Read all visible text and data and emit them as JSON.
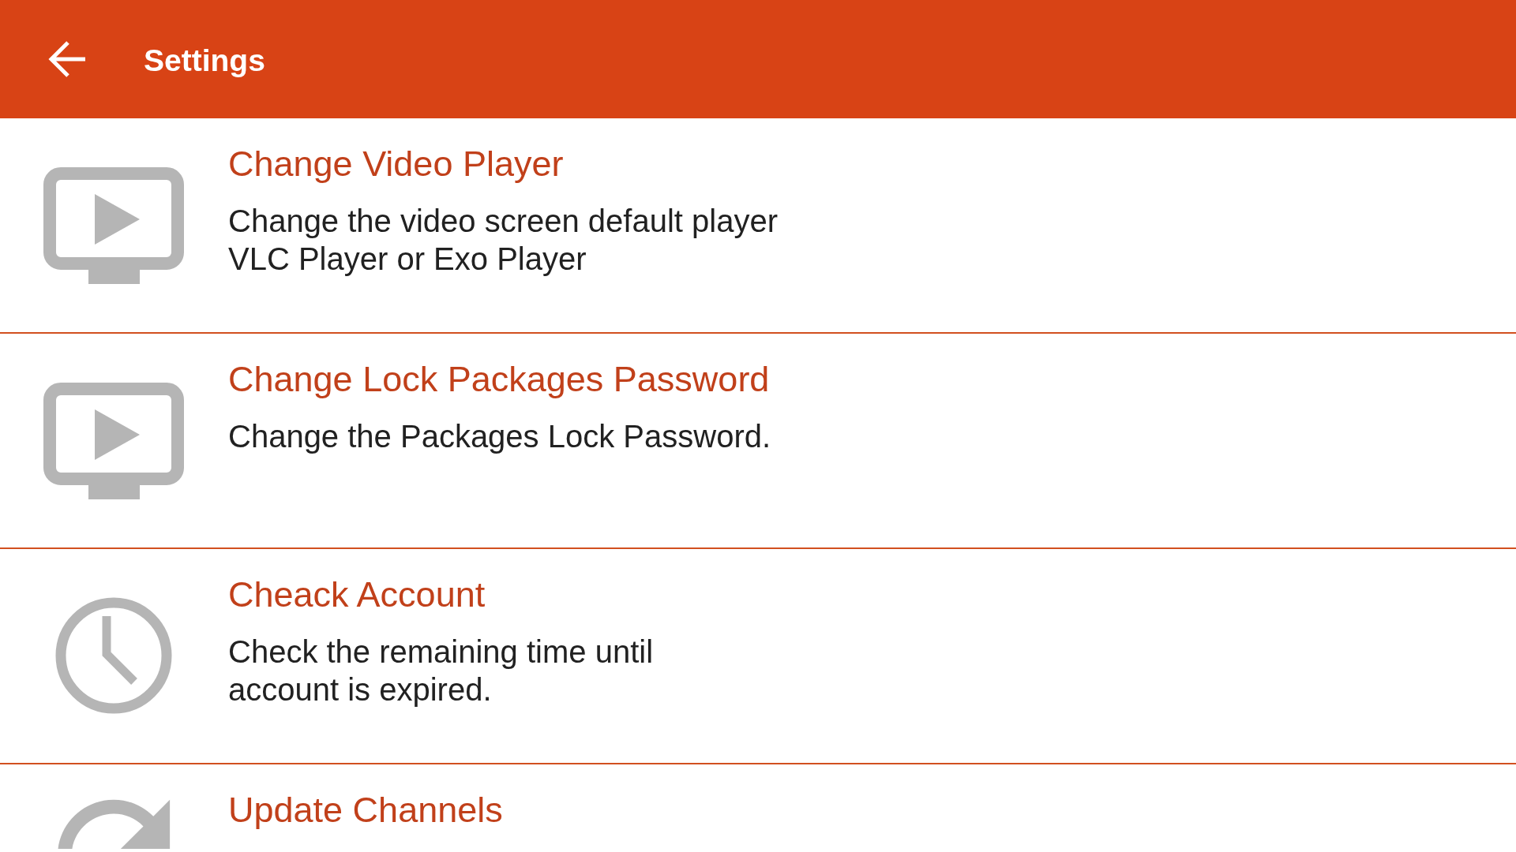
{
  "app_bar": {
    "title": "Settings"
  },
  "settings": [
    {
      "kind": "player",
      "title": "Change Video Player",
      "description": "Change the video screen default player\nVLC Player or Exo Player"
    },
    {
      "kind": "player",
      "title": "Change Lock Packages Password",
      "description": "Change the Packages Lock Password."
    },
    {
      "kind": "clock",
      "title": "Cheack Account",
      "description": "Check the remaining time until\naccount is expired."
    },
    {
      "kind": "refresh",
      "title": "Update Channels"
    }
  ]
}
